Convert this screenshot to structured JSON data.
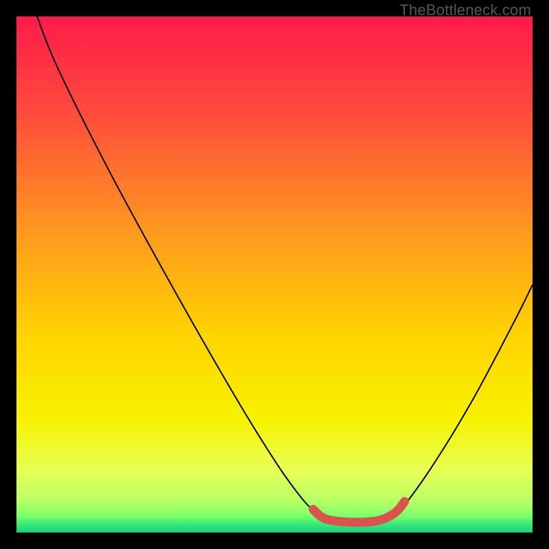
{
  "watermark": "TheBottleneck.com",
  "chart_data": {
    "type": "line",
    "title": "",
    "xlabel": "",
    "ylabel": "",
    "xlim": [
      0,
      100
    ],
    "ylim": [
      0,
      100
    ],
    "grid": false,
    "legend": false,
    "gradient_stops": [
      {
        "offset": 0.0,
        "color": "#ff1a4b"
      },
      {
        "offset": 0.2,
        "color": "#ff4f3a"
      },
      {
        "offset": 0.42,
        "color": "#ff9a1f"
      },
      {
        "offset": 0.62,
        "color": "#ffd400"
      },
      {
        "offset": 0.78,
        "color": "#f7f200"
      },
      {
        "offset": 0.88,
        "color": "#e8ff55"
      },
      {
        "offset": 0.94,
        "color": "#b6ff66"
      },
      {
        "offset": 0.968,
        "color": "#7dff6a"
      },
      {
        "offset": 0.985,
        "color": "#35e87a"
      },
      {
        "offset": 1.0,
        "color": "#17d17a"
      }
    ],
    "series": [
      {
        "name": "bottleneck-curve",
        "stroke": "#000000",
        "stroke_width": 2,
        "points": [
          {
            "x": 4,
            "y": 100
          },
          {
            "x": 8,
            "y": 90
          },
          {
            "x": 18,
            "y": 70
          },
          {
            "x": 30,
            "y": 48
          },
          {
            "x": 42,
            "y": 27
          },
          {
            "x": 50,
            "y": 14
          },
          {
            "x": 55,
            "y": 7
          },
          {
            "x": 58,
            "y": 4
          },
          {
            "x": 61,
            "y": 2.5
          },
          {
            "x": 66,
            "y": 2
          },
          {
            "x": 71,
            "y": 2.5
          },
          {
            "x": 74,
            "y": 4
          },
          {
            "x": 80,
            "y": 12
          },
          {
            "x": 88,
            "y": 25
          },
          {
            "x": 96,
            "y": 40
          },
          {
            "x": 100,
            "y": 48
          }
        ]
      },
      {
        "name": "optimal-zone-highlight",
        "stroke": "#d9544d",
        "stroke_width": 13,
        "linecap": "round",
        "points": [
          {
            "x": 57.5,
            "y": 4.5
          },
          {
            "x": 58.5,
            "y": 3.5
          },
          {
            "x": 60,
            "y": 2.6
          },
          {
            "x": 63,
            "y": 2.1
          },
          {
            "x": 67,
            "y": 2.0
          },
          {
            "x": 70,
            "y": 2.3
          },
          {
            "x": 72,
            "y": 3.0
          },
          {
            "x": 73.8,
            "y": 4.2
          },
          {
            "x": 75.2,
            "y": 6.0
          }
        ]
      }
    ]
  }
}
